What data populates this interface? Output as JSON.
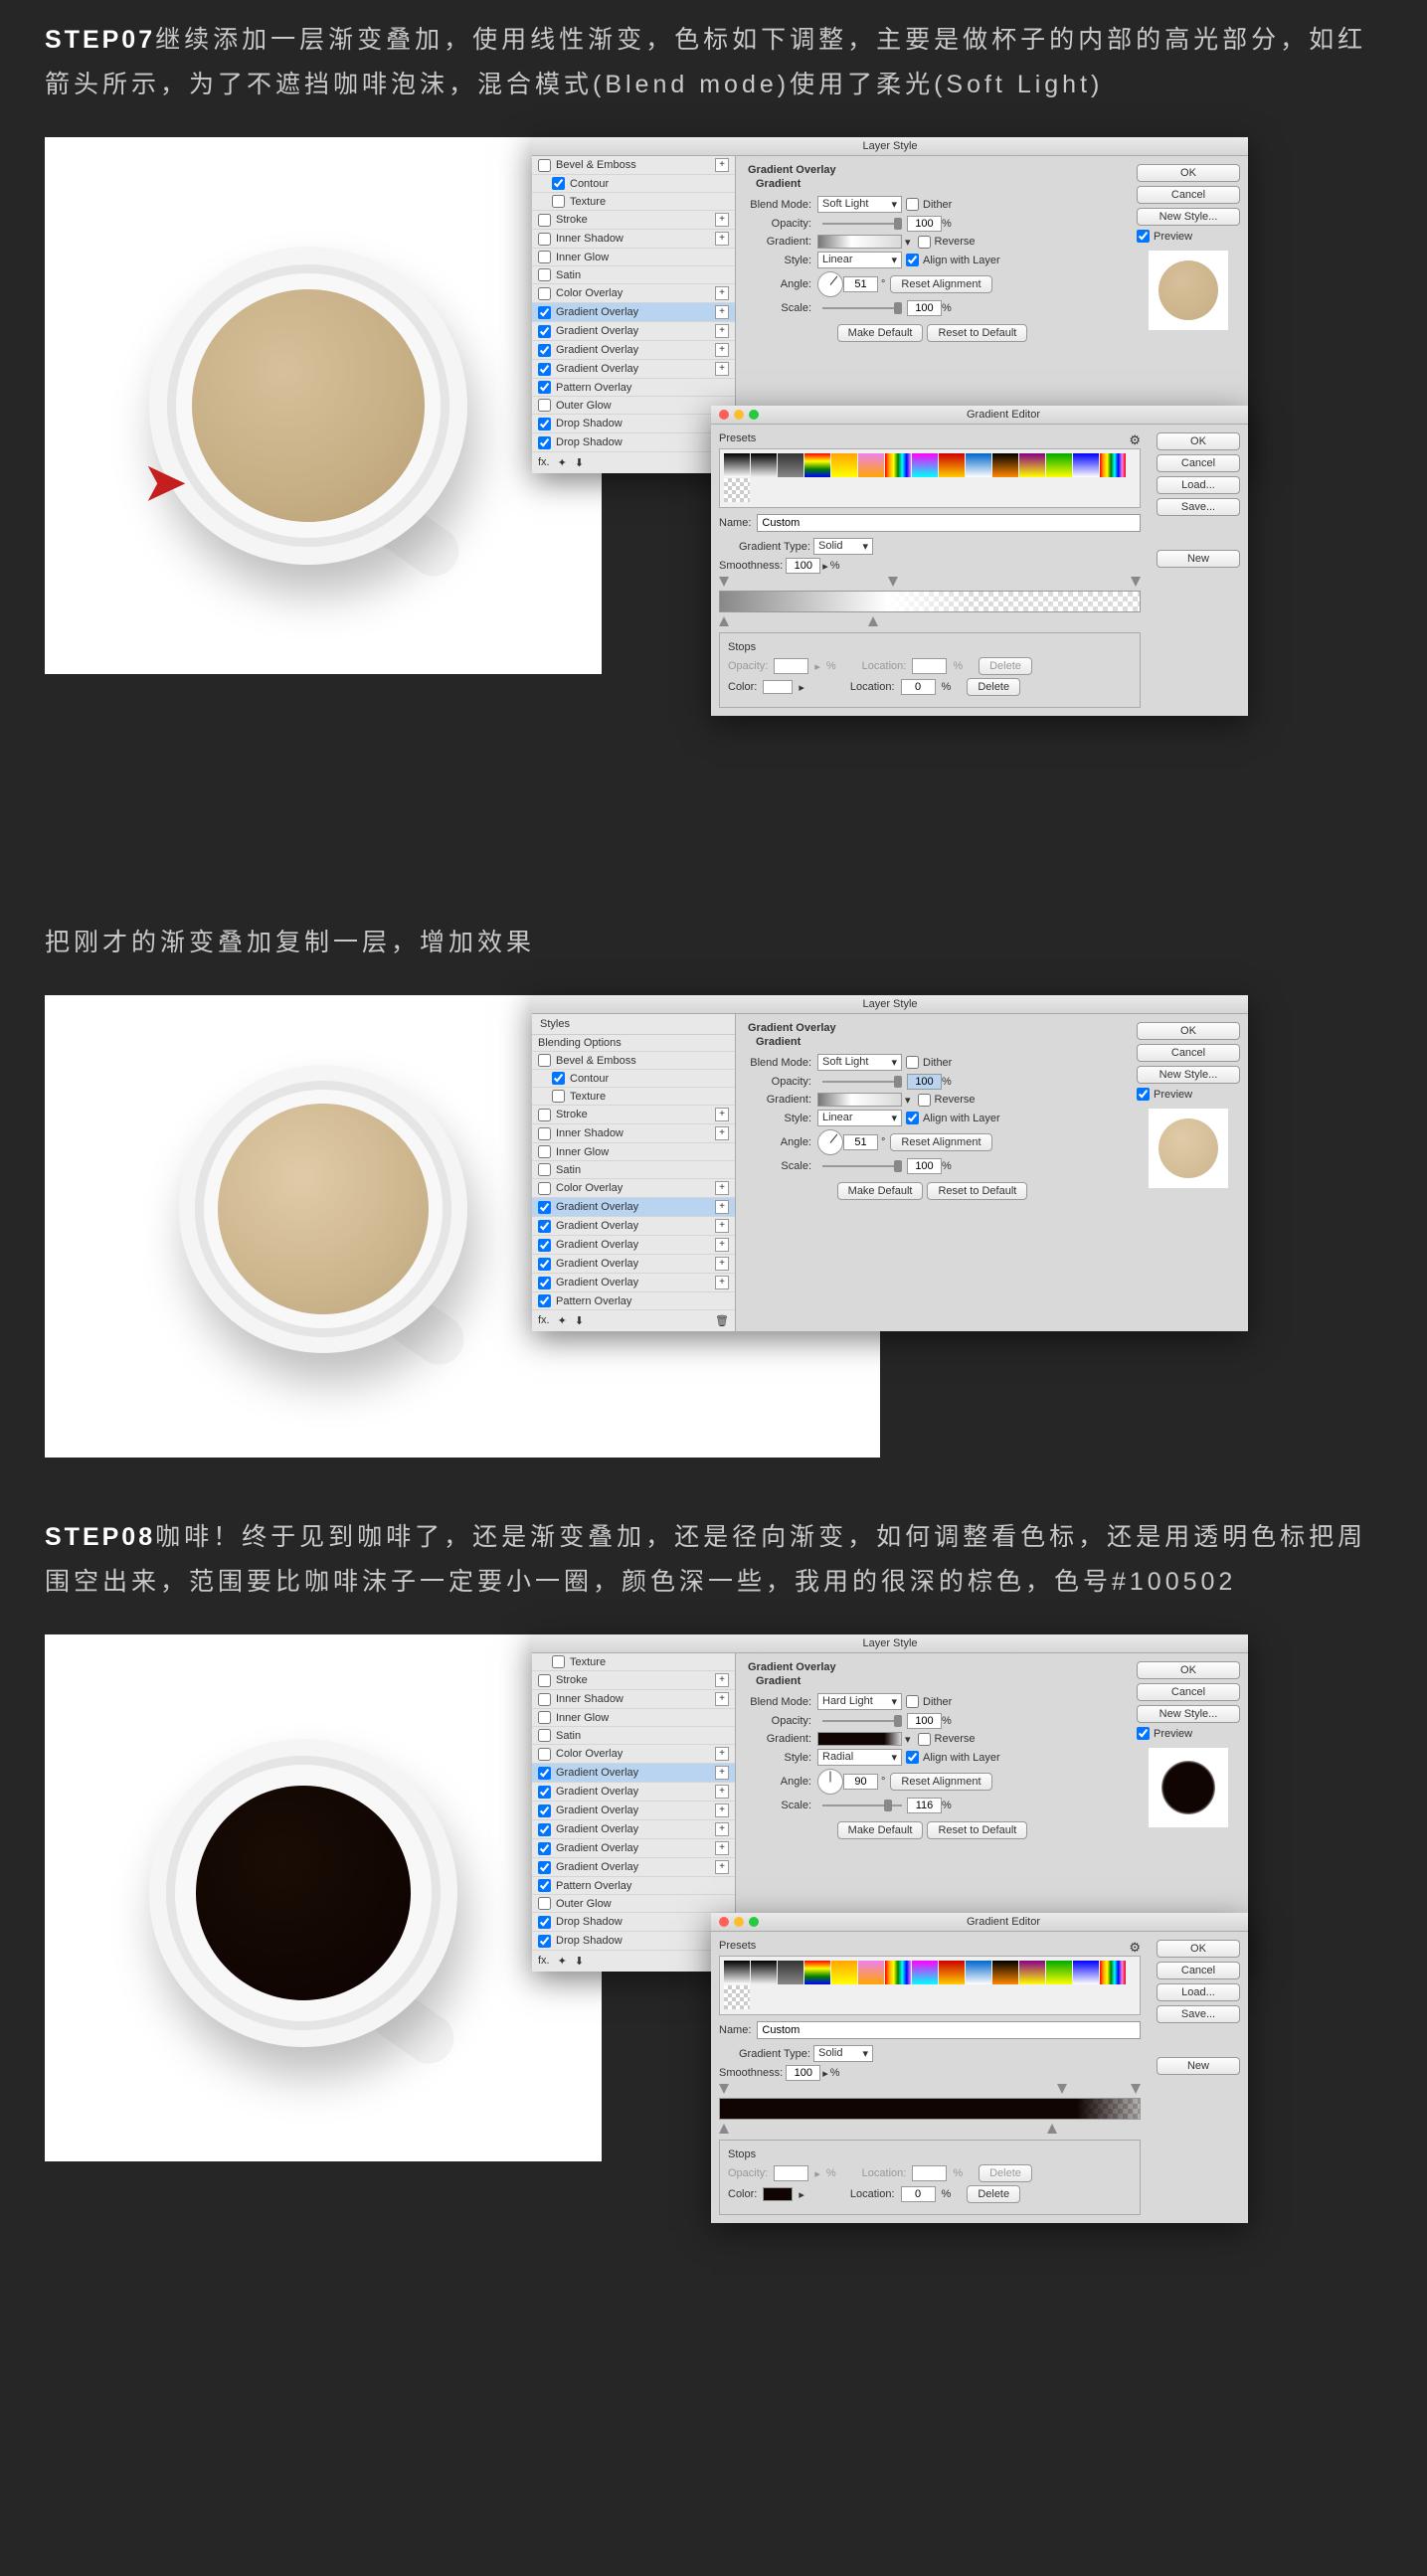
{
  "step07": {
    "label": "STEP07",
    "text": "继续添加一层渐变叠加，使用线性渐变，色标如下调整，主要是做杯子的内部的高光部分，如红箭头所示，为了不遮挡咖啡泡沫，混合模式(Blend mode)使用了柔光(Soft Light)"
  },
  "midtext": "把刚才的渐变叠加复制一层，增加效果",
  "step08": {
    "label": "STEP08",
    "text": "咖啡！终于见到咖啡了，还是渐变叠加，还是径向渐变，如何调整看色标，还是用透明色标把周围空出来，范围要比咖啡沫子一定要小一圈，颜色深一些，我用的很深的棕色，色号#100502"
  },
  "ls": {
    "title": "Layer Style",
    "styles_head": "Styles",
    "blending": "Blending Options",
    "bevel": "Bevel & Emboss",
    "contour": "Contour",
    "texture": "Texture",
    "stroke": "Stroke",
    "inner_shadow": "Inner Shadow",
    "inner_glow": "Inner Glow",
    "satin": "Satin",
    "color_overlay": "Color Overlay",
    "gradient_overlay": "Gradient Overlay",
    "pattern_overlay": "Pattern Overlay",
    "outer_glow": "Outer Glow",
    "drop_shadow": "Drop Shadow",
    "fx": "fx.",
    "sect": "Gradient Overlay",
    "sub": "Gradient",
    "blend_mode": "Blend Mode:",
    "soft_light": "Soft Light",
    "hard_light": "Hard Light",
    "dither": "Dither",
    "opacity": "Opacity:",
    "v100": "100",
    "pct": "%",
    "gradient": "Gradient:",
    "reverse": "Reverse",
    "style": "Style:",
    "linear": "Linear",
    "radial": "Radial",
    "align": "Align with Layer",
    "angle": "Angle:",
    "a51": "51",
    "a90": "90",
    "reset_align": "Reset Alignment",
    "scale": "Scale:",
    "s116": "116",
    "make_default": "Make Default",
    "reset_default": "Reset to Default",
    "ok": "OK",
    "cancel": "Cancel",
    "new_style": "New Style...",
    "preview": "Preview"
  },
  "ged": {
    "title": "Gradient Editor",
    "presets": "Presets",
    "ok": "OK",
    "cancel": "Cancel",
    "load": "Load...",
    "save": "Save...",
    "name": "Name:",
    "custom": "Custom",
    "new": "New",
    "grad_type": "Gradient Type:",
    "solid": "Solid",
    "smoothness": "Smoothness:",
    "v100": "100",
    "pct": "%",
    "stops": "Stops",
    "opacity": "Opacity:",
    "location": "Location:",
    "loc0": "0",
    "color": "Color:",
    "delete": "Delete"
  }
}
